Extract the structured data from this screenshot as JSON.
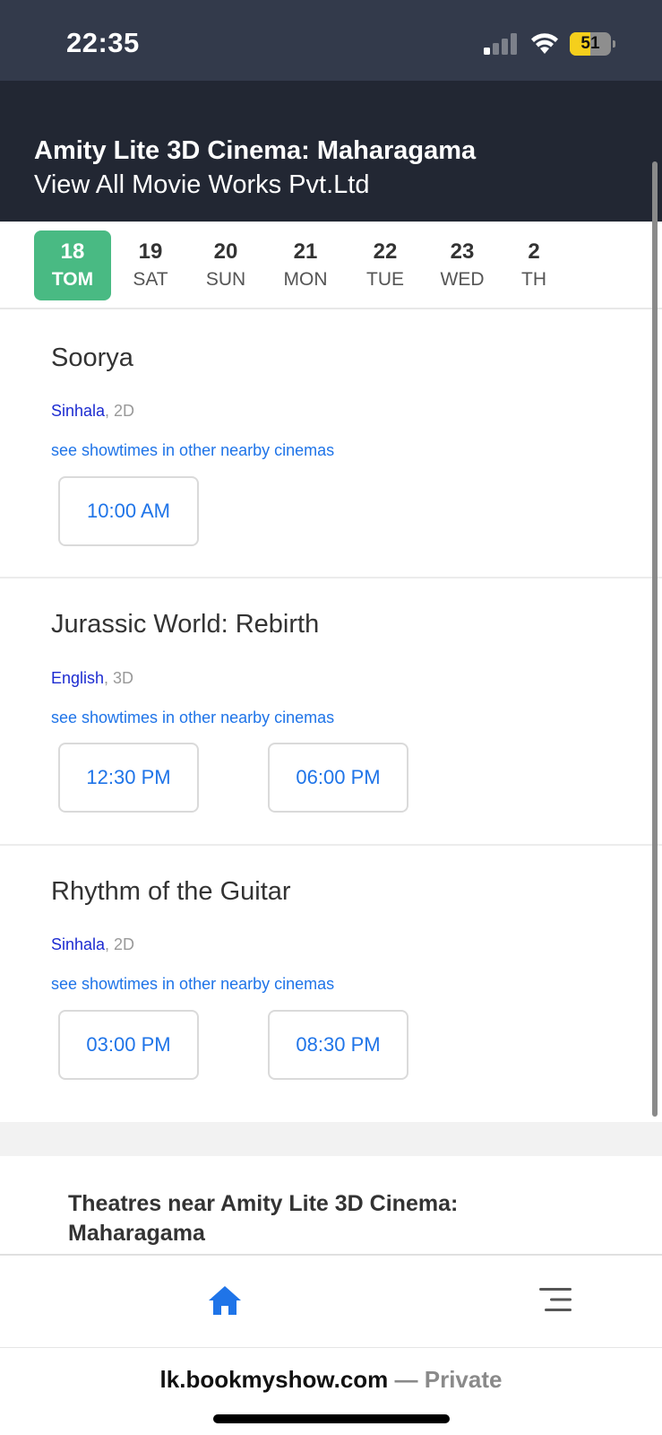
{
  "status_bar": {
    "time": "22:35",
    "battery": "51",
    "icons": [
      "signal-icon",
      "wifi-icon",
      "battery-icon"
    ]
  },
  "header": {
    "title": "Amity Lite 3D Cinema: Maharagama",
    "subtitle": "View All Movie Works Pvt.Ltd"
  },
  "dates": [
    {
      "num": "18",
      "day": "TOM",
      "selected": true
    },
    {
      "num": "19",
      "day": "SAT"
    },
    {
      "num": "20",
      "day": "SUN"
    },
    {
      "num": "21",
      "day": "MON"
    },
    {
      "num": "22",
      "day": "TUE"
    },
    {
      "num": "23",
      "day": "WED"
    },
    {
      "num": "2",
      "day": "TH"
    }
  ],
  "movies": [
    {
      "title": "Soorya",
      "language": "Sinhala",
      "format": ", 2D",
      "link": "see showtimes in other nearby cinemas",
      "showtimes": [
        "10:00 AM"
      ]
    },
    {
      "title": "Jurassic World: Rebirth",
      "language": "English",
      "format": ", 3D",
      "link": "see showtimes in other nearby cinemas",
      "showtimes": [
        "12:30 PM",
        "06:00 PM"
      ]
    },
    {
      "title": "Rhythm of the Guitar",
      "language": "Sinhala",
      "format": ", 2D",
      "link": "see showtimes in other nearby cinemas",
      "showtimes": [
        "03:00 PM",
        "08:30 PM"
      ]
    }
  ],
  "theatres_near": "Theatres near Amity Lite 3D Cinema: Maharagama",
  "bottom_nav": {
    "icons": [
      "home-icon",
      "menu-icon"
    ],
    "active_color": "#1f74e8"
  },
  "browser": {
    "domain": "lk.bookmyshow.com",
    "private_label": " — Private"
  },
  "colors": {
    "accent_green": "#49ba83",
    "link_blue": "#1f74e8",
    "header_bg": "#222733"
  }
}
